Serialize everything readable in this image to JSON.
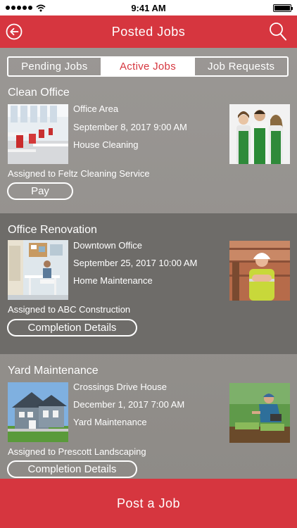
{
  "status_bar": {
    "time": "9:41 AM",
    "signal_icon": "signal-dots-icon",
    "wifi_icon": "wifi-icon",
    "battery_icon": "battery-icon"
  },
  "header": {
    "title": "Posted Jobs",
    "back_icon": "back-arrow-icon",
    "search_icon": "search-icon",
    "brand_color": "#d6363f"
  },
  "tabs": [
    {
      "label": "Pending Jobs",
      "active": false
    },
    {
      "label": "Active Jobs",
      "active": true
    },
    {
      "label": "Job Requests",
      "active": false
    }
  ],
  "jobs": [
    {
      "title": "Clean Office",
      "location": "Office Area",
      "datetime": "September 8, 2017 9:00 AM",
      "category": "House Cleaning",
      "assigned": "Assigned to Feltz Cleaning Service",
      "action_label": "Pay",
      "thumb_icon": "office-photo",
      "avatar_icon": "cleaning-team-photo"
    },
    {
      "title": "Office Renovation",
      "location": "Downtown Office",
      "datetime": "September 25, 2017 10:00 AM",
      "category": "Home Maintenance",
      "assigned": "Assigned to ABC Construction",
      "action_label": "Completion Details",
      "thumb_icon": "office-interior-photo",
      "avatar_icon": "construction-worker-photo"
    },
    {
      "title": "Yard Maintenance",
      "location": "Crossings Drive House",
      "datetime": "December 1, 2017 7:00 AM",
      "category": "Yard Maintenance",
      "assigned": "Assigned to Prescott Landscaping",
      "action_label": "Completion Details",
      "thumb_icon": "house-photo",
      "avatar_icon": "landscaper-photo"
    }
  ],
  "footer": {
    "post_job_label": "Post a Job"
  }
}
